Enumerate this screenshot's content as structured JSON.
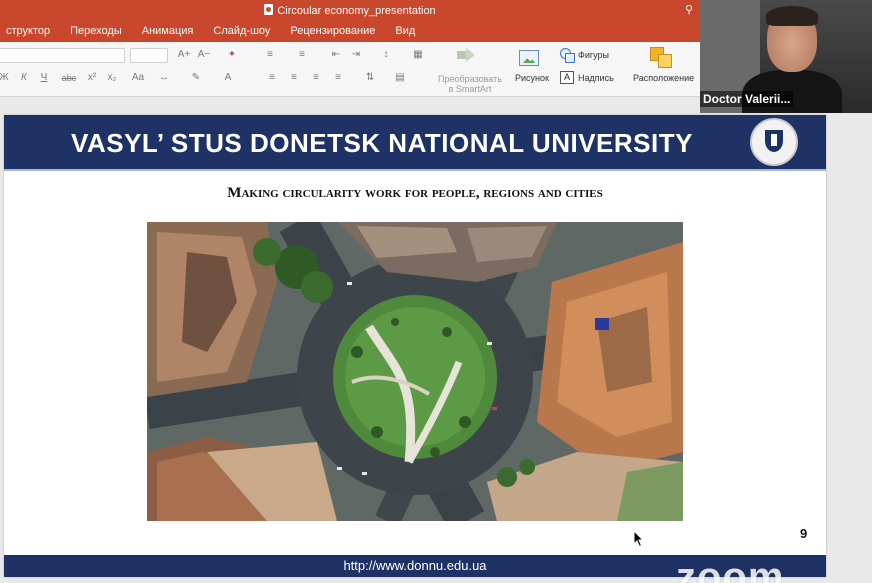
{
  "app": {
    "document_title": "Circoular economy_presentation",
    "tabs": [
      "структор",
      "Переходы",
      "Анимация",
      "Слайд-шоу",
      "Рецензирование",
      "Вид"
    ]
  },
  "ribbon": {
    "smartart_label_line1": "Преобразовать",
    "smartart_label_line2": "в SmartArt",
    "picture_label": "Рисунок",
    "shapes_label": "Фигуры",
    "textbox_label": "Надпись",
    "arrange_label": "Расположение",
    "font_buttons": [
      "A+",
      "A−",
      "Ж",
      "К",
      "Ч",
      "abc",
      "x²",
      "x₂",
      "Aa",
      "A"
    ]
  },
  "webcam": {
    "participant_name": "Doctor Valerii..."
  },
  "slide": {
    "header_title": "VASYL’ STUS DONETSK NATIONAL UNIVERSITY",
    "subtitle": "Making circularity work for people, regions and cities",
    "slide_number": "9",
    "footer_url": "http://www.donnu.edu.ua"
  },
  "overlay": {
    "watermark": "zoom"
  },
  "colors": {
    "ribbon_accent": "#c8472d",
    "slide_navy": "#1f3265"
  }
}
